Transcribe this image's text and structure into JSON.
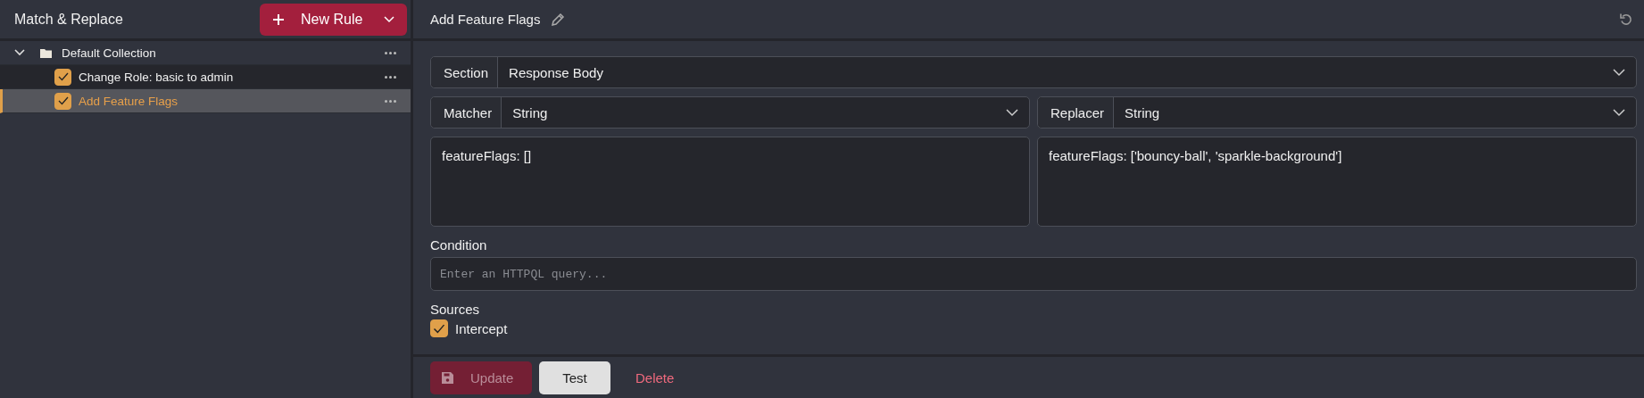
{
  "sidebar": {
    "title": "Match & Replace",
    "new_button": "New Rule",
    "tree": [
      {
        "label": "Default Collection",
        "expanded": true,
        "children": [
          {
            "label": "Change Role: basic to admin",
            "checked": true,
            "selected": false
          },
          {
            "label": "Add Feature Flags",
            "checked": true,
            "selected": true
          }
        ]
      }
    ]
  },
  "editor": {
    "title": "Add Feature Flags",
    "section": {
      "label": "Section",
      "value": "Response Body"
    },
    "matcher": {
      "label": "Matcher",
      "value": "String",
      "text": "featureFlags: []"
    },
    "replacer": {
      "label": "Replacer",
      "value": "String",
      "text": "featureFlags: ['bouncy-ball', 'sparkle-background']"
    },
    "condition": {
      "label": "Condition",
      "placeholder": "Enter an HTTPQL query..."
    },
    "sources": {
      "label": "Sources",
      "items": [
        {
          "label": "Intercept",
          "checked": true
        }
      ]
    },
    "buttons": [
      {
        "label": "Update",
        "kind": "save",
        "disabled": true
      },
      {
        "label": "Test",
        "kind": "secondary",
        "disabled": false
      },
      {
        "label": "Delete",
        "kind": "danger",
        "disabled": false
      }
    ]
  }
}
